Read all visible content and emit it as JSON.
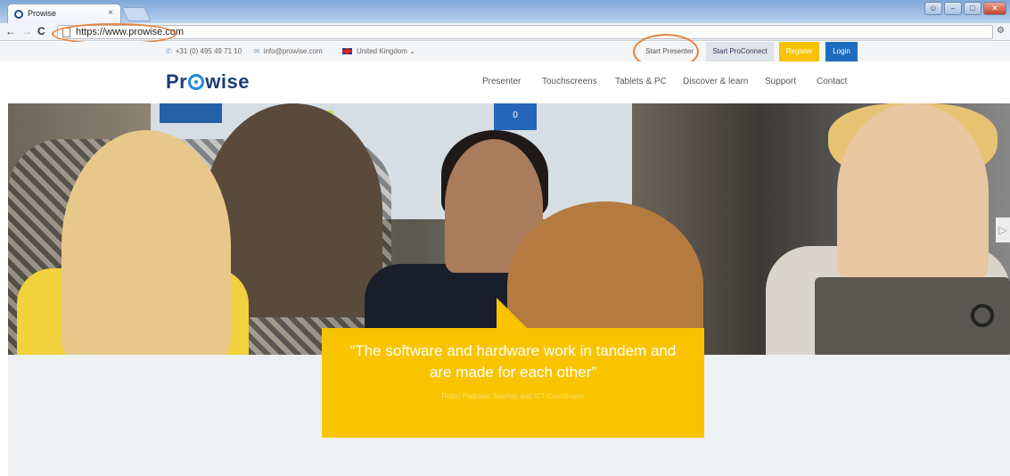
{
  "browser": {
    "tab_title": "Prowise",
    "tab_close": "×",
    "url": "https://www.prowise.com",
    "back": "←",
    "forward": "→",
    "reload": "C"
  },
  "topbar": {
    "phone": "+31 (0) 495 49 71 10",
    "email": "info@prowise.com",
    "country": "United Kingdom",
    "buttons": {
      "start_presenter": "Start Presenter",
      "start_proconnect": "Start ProConnect",
      "register": "Register",
      "login": "Login"
    }
  },
  "header": {
    "logo_pre": "Pr",
    "logo_post": "wise",
    "nav": [
      "Presenter",
      "Touchscreens",
      "Tablets & PC",
      "Discover & learn",
      "Support",
      "Contact"
    ]
  },
  "hero": {
    "quote": "“The software and hardware work in tandem and are made for each other”",
    "author": "Robin Platjouw, Teacher and ICT Coordinator",
    "screen_tile": "0",
    "next_arrow": "▷"
  },
  "colors": {
    "accent_blue": "#1d6dc0",
    "register_yellow": "#f7c200",
    "quote_yellow": "#f8c400",
    "annotation_orange": "#e8823a"
  }
}
